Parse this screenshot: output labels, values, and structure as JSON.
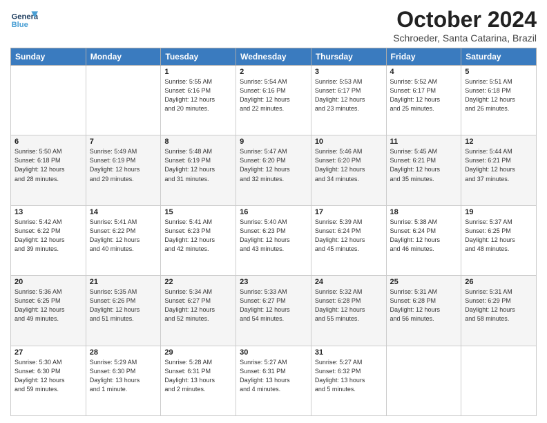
{
  "header": {
    "logo_general": "General",
    "logo_blue": "Blue",
    "month_title": "October 2024",
    "subtitle": "Schroeder, Santa Catarina, Brazil"
  },
  "days_of_week": [
    "Sunday",
    "Monday",
    "Tuesday",
    "Wednesday",
    "Thursday",
    "Friday",
    "Saturday"
  ],
  "weeks": [
    [
      {
        "day": "",
        "info": ""
      },
      {
        "day": "",
        "info": ""
      },
      {
        "day": "1",
        "info": "Sunrise: 5:55 AM\nSunset: 6:16 PM\nDaylight: 12 hours\nand 20 minutes."
      },
      {
        "day": "2",
        "info": "Sunrise: 5:54 AM\nSunset: 6:16 PM\nDaylight: 12 hours\nand 22 minutes."
      },
      {
        "day": "3",
        "info": "Sunrise: 5:53 AM\nSunset: 6:17 PM\nDaylight: 12 hours\nand 23 minutes."
      },
      {
        "day": "4",
        "info": "Sunrise: 5:52 AM\nSunset: 6:17 PM\nDaylight: 12 hours\nand 25 minutes."
      },
      {
        "day": "5",
        "info": "Sunrise: 5:51 AM\nSunset: 6:18 PM\nDaylight: 12 hours\nand 26 minutes."
      }
    ],
    [
      {
        "day": "6",
        "info": "Sunrise: 5:50 AM\nSunset: 6:18 PM\nDaylight: 12 hours\nand 28 minutes."
      },
      {
        "day": "7",
        "info": "Sunrise: 5:49 AM\nSunset: 6:19 PM\nDaylight: 12 hours\nand 29 minutes."
      },
      {
        "day": "8",
        "info": "Sunrise: 5:48 AM\nSunset: 6:19 PM\nDaylight: 12 hours\nand 31 minutes."
      },
      {
        "day": "9",
        "info": "Sunrise: 5:47 AM\nSunset: 6:20 PM\nDaylight: 12 hours\nand 32 minutes."
      },
      {
        "day": "10",
        "info": "Sunrise: 5:46 AM\nSunset: 6:20 PM\nDaylight: 12 hours\nand 34 minutes."
      },
      {
        "day": "11",
        "info": "Sunrise: 5:45 AM\nSunset: 6:21 PM\nDaylight: 12 hours\nand 35 minutes."
      },
      {
        "day": "12",
        "info": "Sunrise: 5:44 AM\nSunset: 6:21 PM\nDaylight: 12 hours\nand 37 minutes."
      }
    ],
    [
      {
        "day": "13",
        "info": "Sunrise: 5:42 AM\nSunset: 6:22 PM\nDaylight: 12 hours\nand 39 minutes."
      },
      {
        "day": "14",
        "info": "Sunrise: 5:41 AM\nSunset: 6:22 PM\nDaylight: 12 hours\nand 40 minutes."
      },
      {
        "day": "15",
        "info": "Sunrise: 5:41 AM\nSunset: 6:23 PM\nDaylight: 12 hours\nand 42 minutes."
      },
      {
        "day": "16",
        "info": "Sunrise: 5:40 AM\nSunset: 6:23 PM\nDaylight: 12 hours\nand 43 minutes."
      },
      {
        "day": "17",
        "info": "Sunrise: 5:39 AM\nSunset: 6:24 PM\nDaylight: 12 hours\nand 45 minutes."
      },
      {
        "day": "18",
        "info": "Sunrise: 5:38 AM\nSunset: 6:24 PM\nDaylight: 12 hours\nand 46 minutes."
      },
      {
        "day": "19",
        "info": "Sunrise: 5:37 AM\nSunset: 6:25 PM\nDaylight: 12 hours\nand 48 minutes."
      }
    ],
    [
      {
        "day": "20",
        "info": "Sunrise: 5:36 AM\nSunset: 6:25 PM\nDaylight: 12 hours\nand 49 minutes."
      },
      {
        "day": "21",
        "info": "Sunrise: 5:35 AM\nSunset: 6:26 PM\nDaylight: 12 hours\nand 51 minutes."
      },
      {
        "day": "22",
        "info": "Sunrise: 5:34 AM\nSunset: 6:27 PM\nDaylight: 12 hours\nand 52 minutes."
      },
      {
        "day": "23",
        "info": "Sunrise: 5:33 AM\nSunset: 6:27 PM\nDaylight: 12 hours\nand 54 minutes."
      },
      {
        "day": "24",
        "info": "Sunrise: 5:32 AM\nSunset: 6:28 PM\nDaylight: 12 hours\nand 55 minutes."
      },
      {
        "day": "25",
        "info": "Sunrise: 5:31 AM\nSunset: 6:28 PM\nDaylight: 12 hours\nand 56 minutes."
      },
      {
        "day": "26",
        "info": "Sunrise: 5:31 AM\nSunset: 6:29 PM\nDaylight: 12 hours\nand 58 minutes."
      }
    ],
    [
      {
        "day": "27",
        "info": "Sunrise: 5:30 AM\nSunset: 6:30 PM\nDaylight: 12 hours\nand 59 minutes."
      },
      {
        "day": "28",
        "info": "Sunrise: 5:29 AM\nSunset: 6:30 PM\nDaylight: 13 hours\nand 1 minute."
      },
      {
        "day": "29",
        "info": "Sunrise: 5:28 AM\nSunset: 6:31 PM\nDaylight: 13 hours\nand 2 minutes."
      },
      {
        "day": "30",
        "info": "Sunrise: 5:27 AM\nSunset: 6:31 PM\nDaylight: 13 hours\nand 4 minutes."
      },
      {
        "day": "31",
        "info": "Sunrise: 5:27 AM\nSunset: 6:32 PM\nDaylight: 13 hours\nand 5 minutes."
      },
      {
        "day": "",
        "info": ""
      },
      {
        "day": "",
        "info": ""
      }
    ]
  ]
}
